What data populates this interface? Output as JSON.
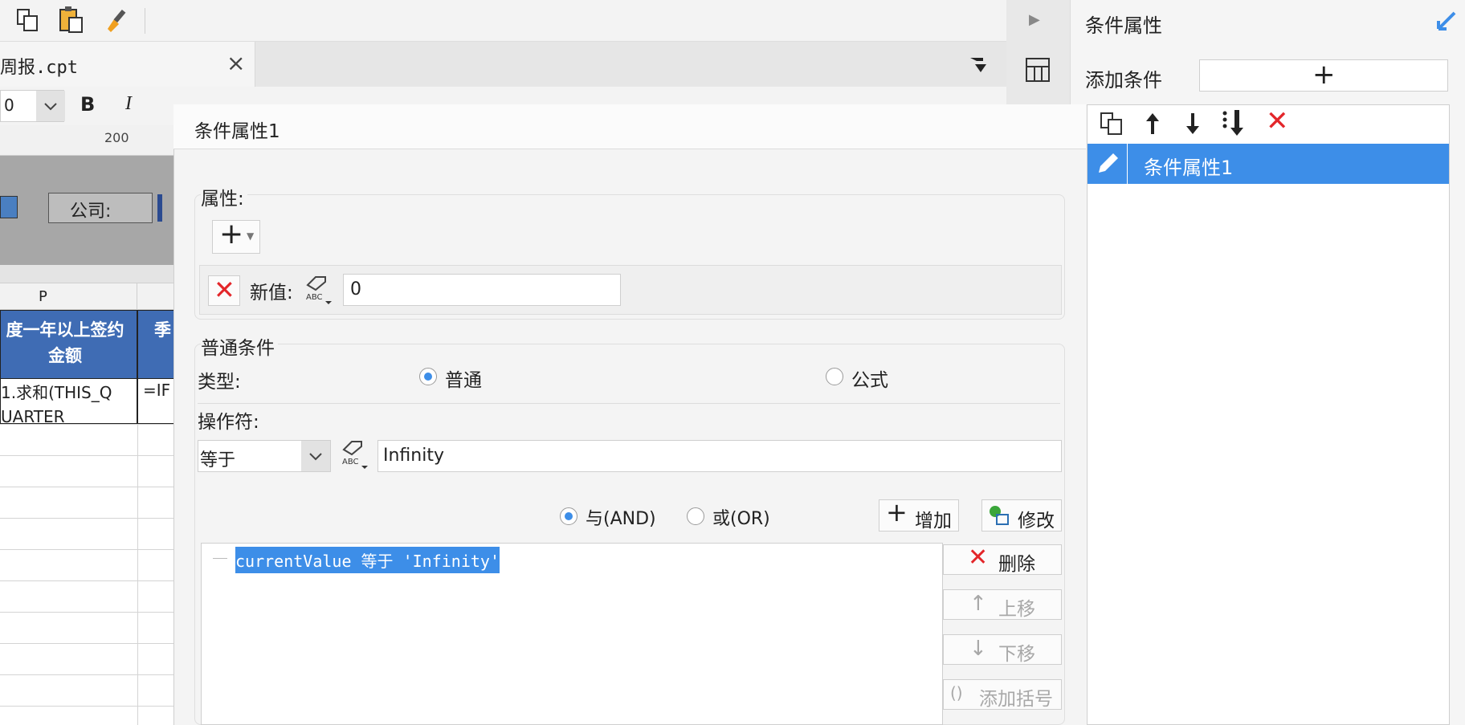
{
  "file_tab": {
    "title": "周报.cpt",
    "close": "×"
  },
  "format_bar": {
    "font_size": "0"
  },
  "ruler": {
    "mark": "200"
  },
  "param_panel": {
    "company_label": "公司:"
  },
  "sheet": {
    "col_p": "P",
    "header_p": "度一年以上签约金额",
    "header_q": "季",
    "cell_p": "1.求和(THIS_QUARTER_",
    "cell_q": "=IF"
  },
  "right_panel": {
    "title": "条件属性",
    "add_condition_label": "添加条件",
    "add_btn": "+",
    "items": [
      "条件属性1"
    ]
  },
  "dialog": {
    "title": "条件属性1",
    "attr_group_label": "属性:",
    "add_attr": "+",
    "new_value_label": "新值:",
    "new_value": "0",
    "normal_group_label": "普通条件",
    "type_label": "类型:",
    "type_normal": "普通",
    "type_formula": "公式",
    "operator_label": "操作符:",
    "operator_value": "等于",
    "operand_value": "Infinity",
    "and_label": "与(AND)",
    "or_label": "或(OR)",
    "add_btn": "增加",
    "modify_btn": "修改",
    "condition_item": "currentValue 等于 'Infinity'",
    "delete_btn": "删除",
    "up_btn": "上移",
    "down_btn": "下移",
    "bracket_btn": "添加括号"
  }
}
